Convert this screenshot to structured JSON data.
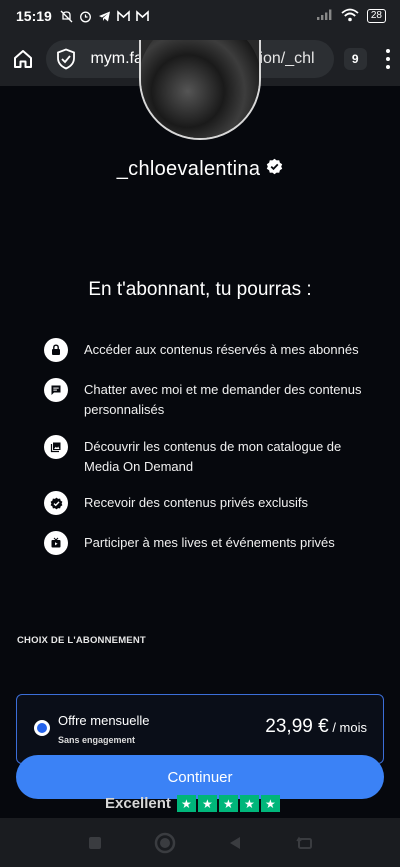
{
  "status_bar": {
    "time": "15:19",
    "battery": "28",
    "icons": [
      "mute-icon",
      "alarm-icon",
      "telegram-icon",
      "gmail-icon",
      "gmail-icon",
      "signal-icon",
      "wifi-icon",
      "battery-icon"
    ]
  },
  "browser": {
    "url_host": "mym.fans",
    "url_path": "/app/subscription/_chl",
    "tab_count": "9"
  },
  "profile": {
    "username": "_chloevalentina"
  },
  "benefits": {
    "title": "En t'abonnant, tu pourras :",
    "items": [
      {
        "icon": "lock-icon",
        "text": "Accéder aux contenus réservés à mes abonnés"
      },
      {
        "icon": "chat-icon",
        "text": "Chatter avec moi et me demander des contenus personnalisés"
      },
      {
        "icon": "gallery-icon",
        "text": "Découvrir les contenus de mon catalogue de Media On Demand"
      },
      {
        "icon": "verified-icon",
        "text": "Recevoir des contenus privés exclusifs"
      },
      {
        "icon": "live-icon",
        "text": "Participer à mes lives et événements privés"
      }
    ]
  },
  "subscription": {
    "section_label": "CHOIX DE L'ABONNEMENT",
    "plan_name": "Offre mensuelle",
    "plan_sub": "Sans engagement",
    "price": "23,99 €",
    "period": " / mois",
    "selected": true
  },
  "cta": {
    "label": "Continuer"
  },
  "trustpilot": {
    "label": "Excellent",
    "stars": 5
  },
  "colors": {
    "background": "#06080d",
    "accent": "#3b82f6",
    "card_border": "#3b6ed8",
    "trustpilot_green": "#00b67a"
  }
}
